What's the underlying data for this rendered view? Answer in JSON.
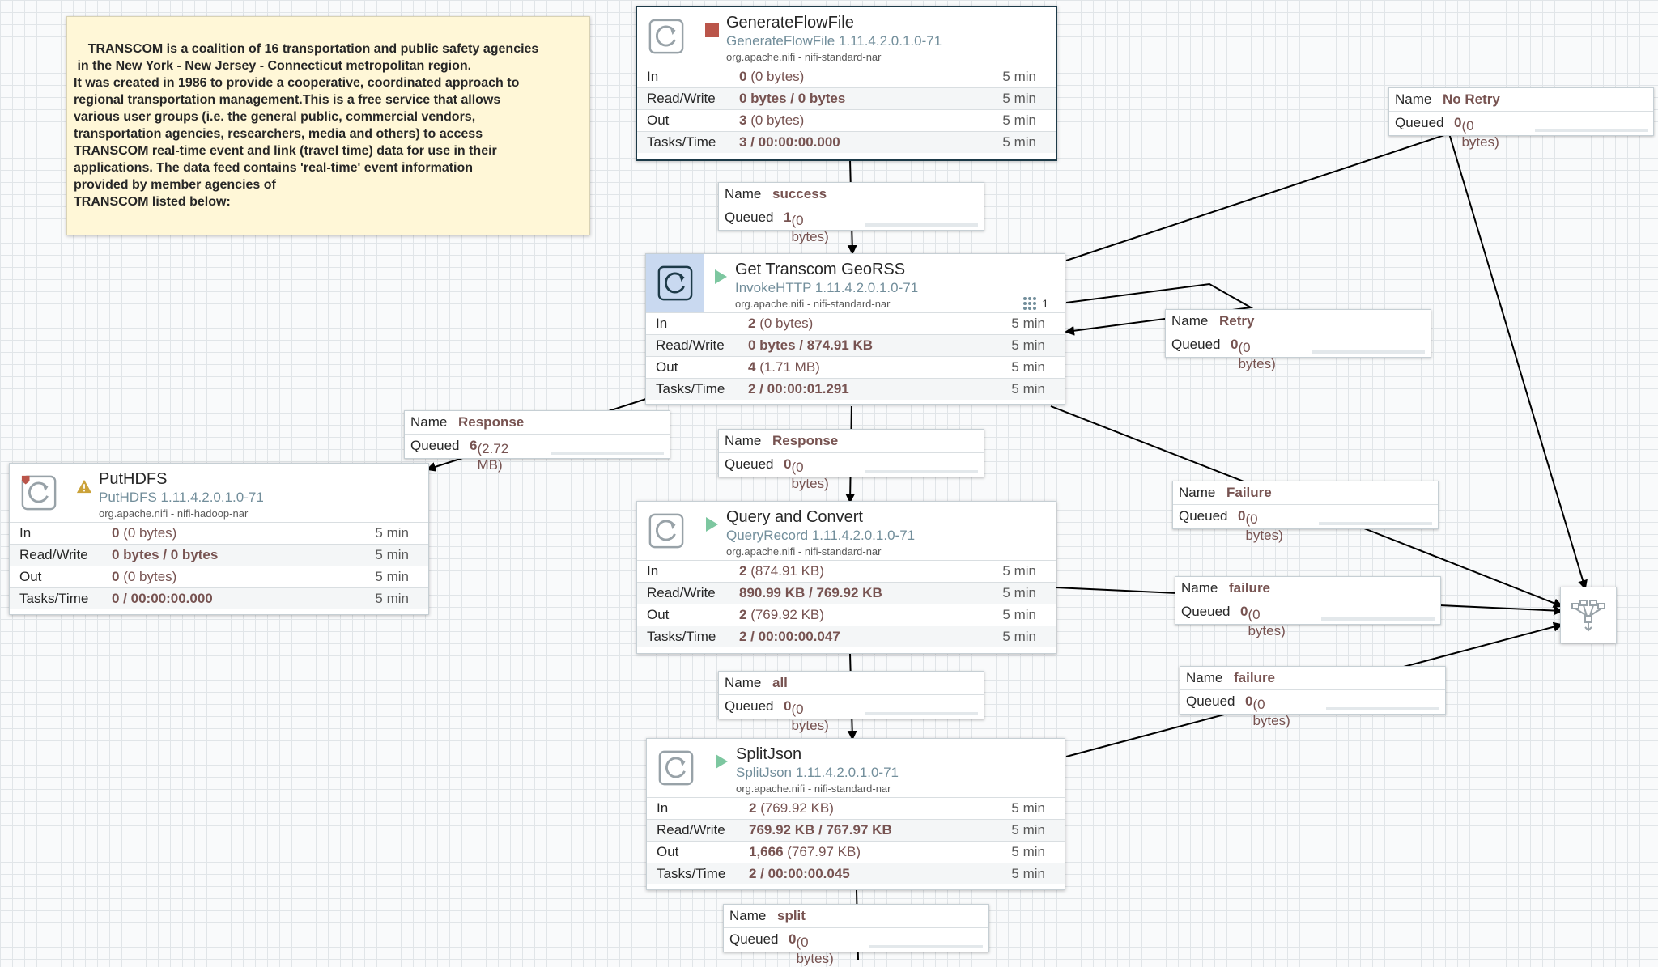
{
  "note": {
    "text": "TRANSCOM is a coalition of 16 transportation and public safety agencies\n in the New York - New Jersey - Connecticut metropolitan region.\nIt was created in 1986 to provide a cooperative, coordinated approach to\nregional transportation management.This is a free service that allows\nvarious user groups (i.e. the general public, commercial vendors,\ntransportation agencies, researchers, media and others) to access\nTRANSCOM real-time event and link (travel time) data for use in their\napplications. The data feed contains 'real-time' event information\nprovided by member agencies of\nTRANSCOM listed below:"
  },
  "stat_keys": {
    "in": "In",
    "rw": "Read/Write",
    "out": "Out",
    "tasks": "Tasks/Time"
  },
  "conn_keys": {
    "name": "Name",
    "queued": "Queued"
  },
  "processors": {
    "generate": {
      "name": "GenerateFlowFile",
      "type": "GenerateFlowFile 1.11.4.2.0.1.0-71",
      "bundle": "org.apache.nifi - nifi-standard-nar",
      "status": "stopped",
      "in_n": "0",
      "in_s": " (0 bytes)",
      "rw": "0 bytes / 0 bytes",
      "out_n": "3",
      "out_s": " (0 bytes)",
      "tasks": "3 / 00:00:00.000",
      "window": "5 min"
    },
    "geors": {
      "name": "Get Transcom GeoRSS",
      "type": "InvokeHTTP 1.11.4.2.0.1.0-71",
      "bundle": "org.apache.nifi - nifi-standard-nar",
      "status": "running",
      "active_threads": "1",
      "in_n": "2",
      "in_s": " (0 bytes)",
      "rw": "0 bytes / 874.91 KB",
      "out_n": "4",
      "out_s": " (1.71 MB)",
      "tasks": "2 / 00:00:01.291",
      "window": "5 min"
    },
    "puthdfs": {
      "name": "PutHDFS",
      "type": "PutHDFS 1.11.4.2.0.1.0-71",
      "bundle": "org.apache.nifi - nifi-hadoop-nar",
      "status": "invalid",
      "in_n": "0",
      "in_s": " (0 bytes)",
      "rw": "0 bytes / 0 bytes",
      "out_n": "0",
      "out_s": " (0 bytes)",
      "tasks": "0 / 00:00:00.000",
      "window": "5 min"
    },
    "query": {
      "name": "Query and Convert",
      "type": "QueryRecord 1.11.4.2.0.1.0-71",
      "bundle": "org.apache.nifi - nifi-standard-nar",
      "status": "running",
      "in_n": "2",
      "in_s": " (874.91 KB)",
      "rw": "890.99 KB / 769.92 KB",
      "out_n": "2",
      "out_s": " (769.92 KB)",
      "tasks": "2 / 00:00:00.047",
      "window": "5 min"
    },
    "split": {
      "name": "SplitJson",
      "type": "SplitJson 1.11.4.2.0.1.0-71",
      "bundle": "org.apache.nifi - nifi-standard-nar",
      "status": "running",
      "in_n": "2",
      "in_s": " (769.92 KB)",
      "rw": "769.92 KB / 767.97 KB",
      "out_n": "1,666",
      "out_s": " (767.97 KB)",
      "tasks": "2 / 00:00:00.045",
      "window": "5 min"
    }
  },
  "connections": {
    "success": {
      "name": "success",
      "count": "1",
      "size": " (0 bytes)"
    },
    "noretry": {
      "name": "No Retry",
      "count": "0",
      "size": " (0 bytes)"
    },
    "retry": {
      "name": "Retry",
      "count": "0",
      "size": " (0 bytes)"
    },
    "resp_left": {
      "name": "Response",
      "count": "6",
      "size": " (2.72 MB)"
    },
    "resp_mid": {
      "name": "Response",
      "count": "0",
      "size": " (0 bytes)"
    },
    "failure1": {
      "name": "Failure",
      "count": "0",
      "size": " (0 bytes)"
    },
    "failure2": {
      "name": "failure",
      "count": "0",
      "size": " (0 bytes)"
    },
    "failure3": {
      "name": "failure",
      "count": "0",
      "size": " (0 bytes)"
    },
    "all": {
      "name": "all",
      "count": "0",
      "size": " (0 bytes)"
    },
    "split": {
      "name": "split",
      "count": "0",
      "size": " (0 bytes)"
    }
  },
  "colors": {
    "running": "#7dc7a0",
    "stopped": "#ba554a",
    "invalid": "#cba239",
    "selected_border": "#1d3a48"
  },
  "icons": {
    "processor": "processor-icon",
    "funnel": "funnel-icon",
    "run": "play-icon",
    "stop": "stop-icon",
    "warn": "warning-icon",
    "threads": "thread-icon"
  }
}
